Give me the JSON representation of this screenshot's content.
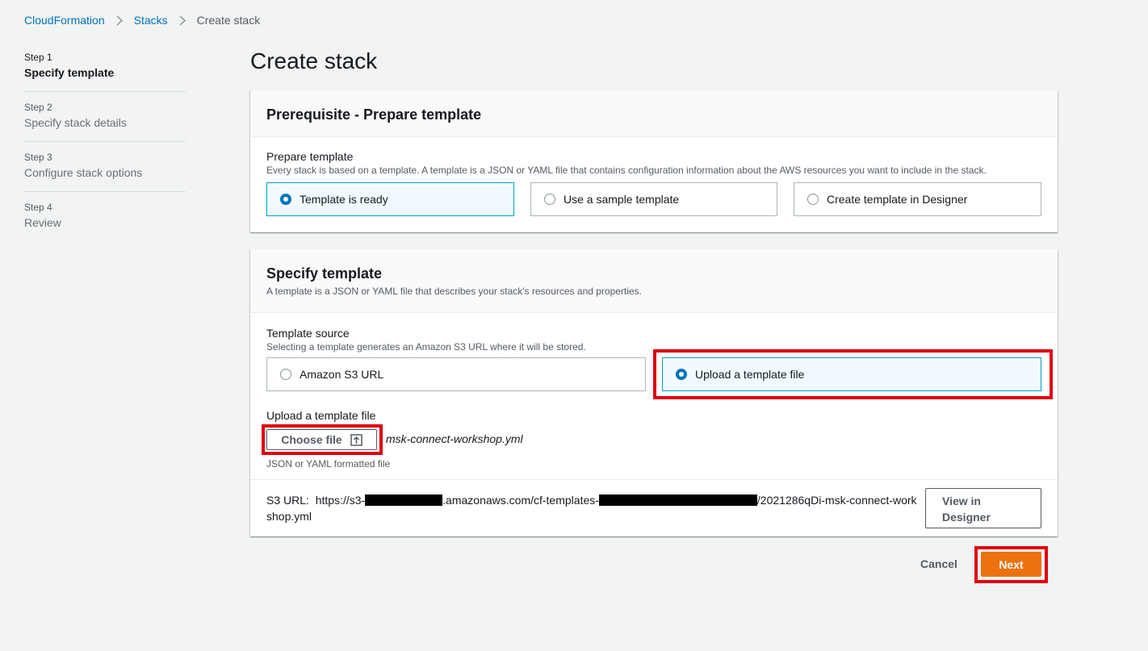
{
  "breadcrumb": {
    "items": [
      "CloudFormation",
      "Stacks"
    ],
    "current": "Create stack"
  },
  "steps": [
    {
      "num": "Step 1",
      "title": "Specify template"
    },
    {
      "num": "Step 2",
      "title": "Specify stack details"
    },
    {
      "num": "Step 3",
      "title": "Configure stack options"
    },
    {
      "num": "Step 4",
      "title": "Review"
    }
  ],
  "page_title": "Create stack",
  "prerequisite": {
    "heading": "Prerequisite - Prepare template",
    "field_label": "Prepare template",
    "field_desc": "Every stack is based on a template. A template is a JSON or YAML file that contains configuration information about the AWS resources you want to include in the stack.",
    "options": [
      "Template is ready",
      "Use a sample template",
      "Create template in Designer"
    ],
    "selected": "Template is ready"
  },
  "specify": {
    "heading": "Specify template",
    "desc": "A template is a JSON or YAML file that describes your stack's resources and properties.",
    "source_label": "Template source",
    "source_desc": "Selecting a template generates an Amazon S3 URL where it will be stored.",
    "source_options": [
      "Amazon S3 URL",
      "Upload a template file"
    ],
    "source_selected": "Upload a template file",
    "upload_label": "Upload a template file",
    "choose_file_label": "Choose file",
    "file_name": "msk-connect-workshop.yml",
    "file_hint": "JSON or YAML formatted file",
    "s3_url_label": "S3 URL:",
    "s3_url_part1": "https://s3-",
    "s3_url_part2": ".amazonaws.com/cf-templates-",
    "s3_url_part3": "/2021286qDi-msk-connect-workshop.yml",
    "view_designer_label": "View in Designer"
  },
  "footer": {
    "cancel_label": "Cancel",
    "next_label": "Next"
  },
  "colors": {
    "accent": "#0073bb",
    "primary_button": "#ec7211",
    "highlight": "#e0000f"
  }
}
